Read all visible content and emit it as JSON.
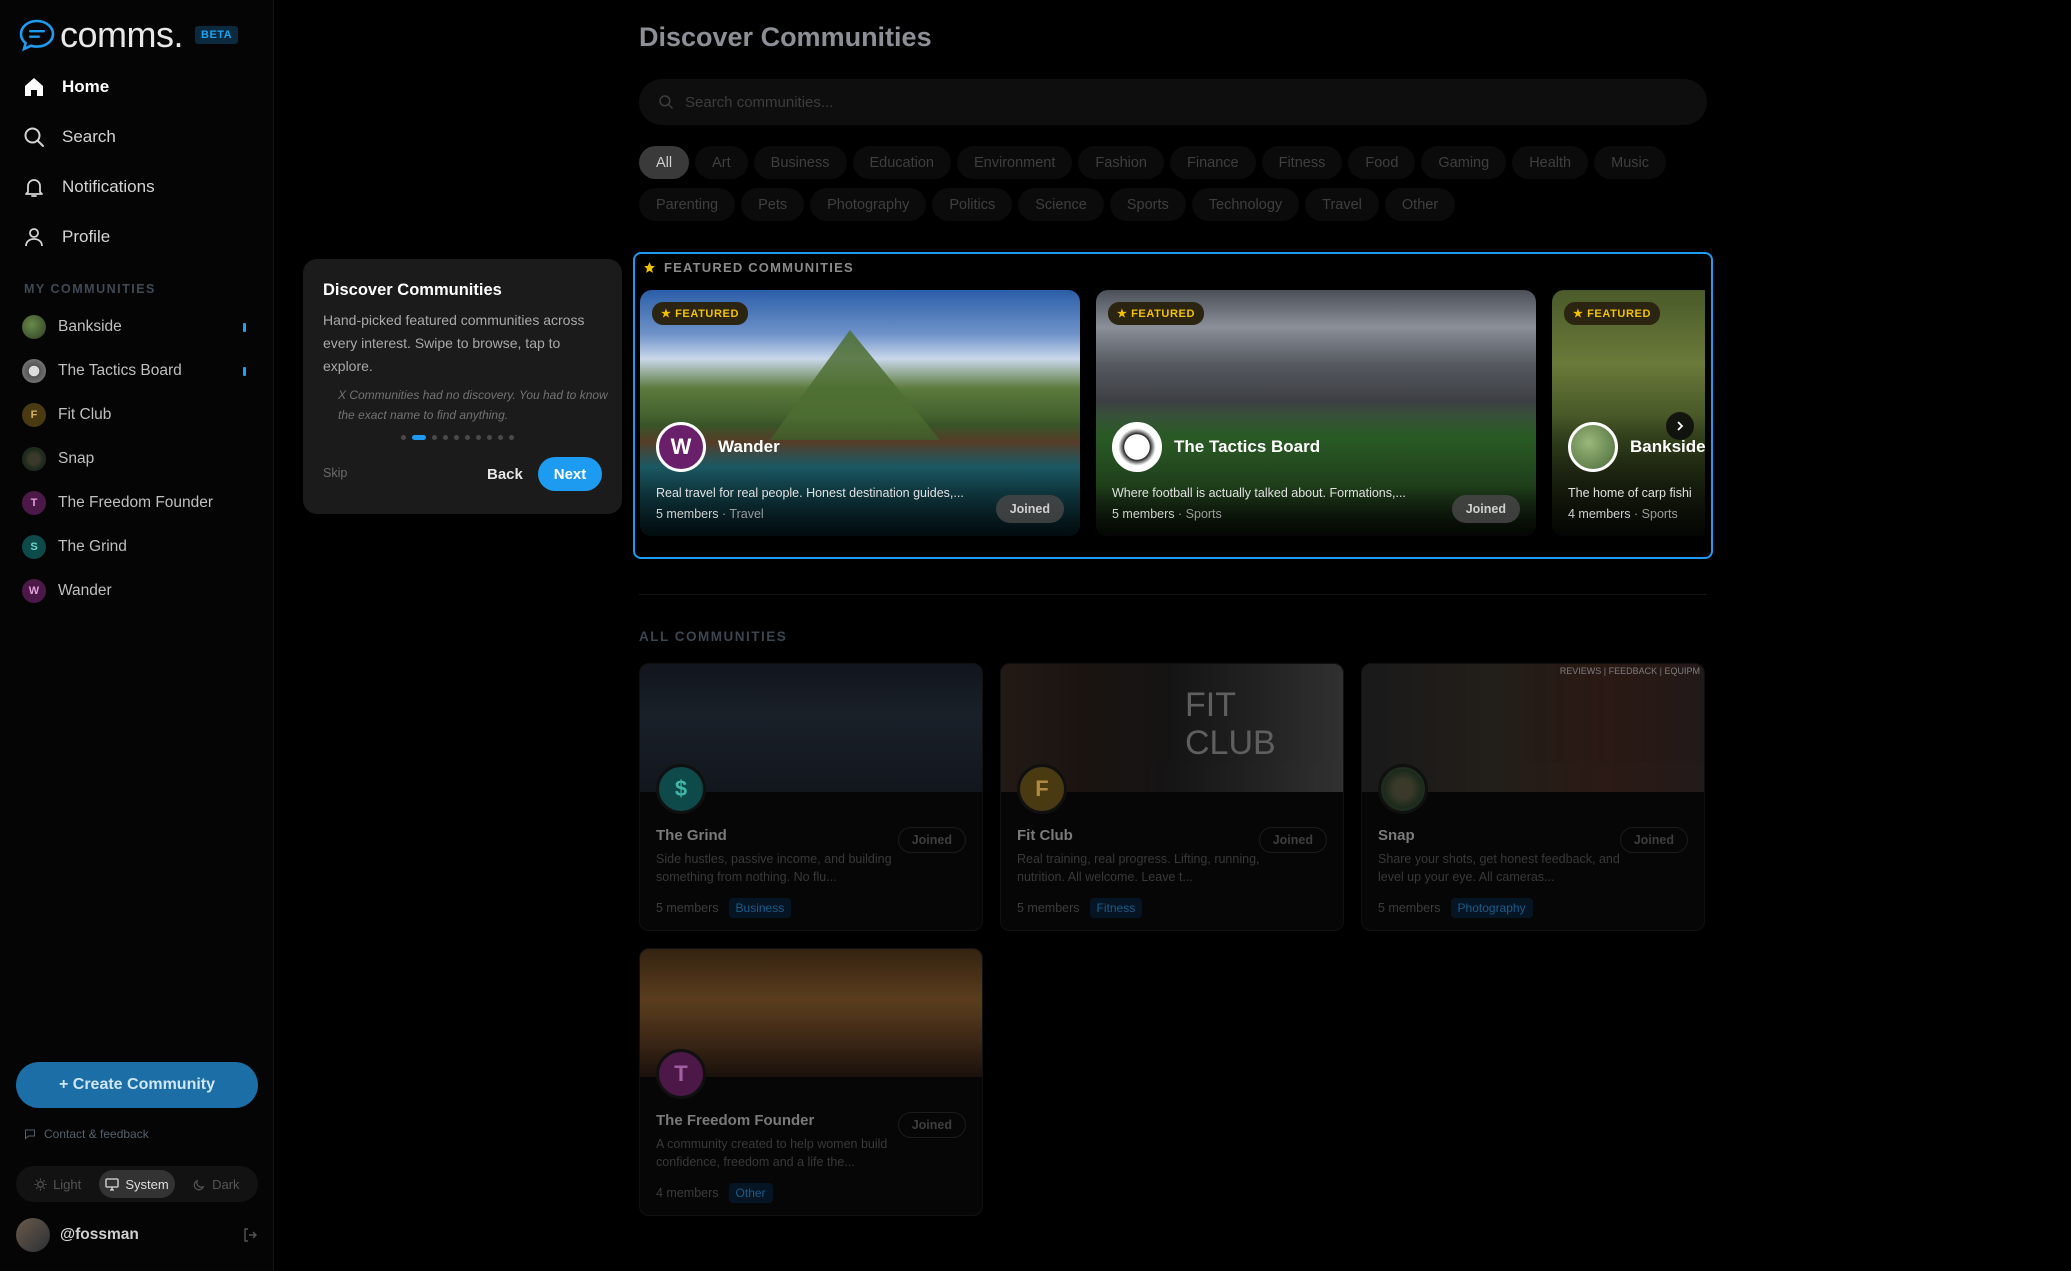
{
  "app": {
    "logo_text": "comms.",
    "beta_badge": "BETA"
  },
  "nav": [
    {
      "label": "Home",
      "icon": "home-icon"
    },
    {
      "label": "Search",
      "icon": "search-icon"
    },
    {
      "label": "Notifications",
      "icon": "bell-icon"
    },
    {
      "label": "Profile",
      "icon": "user-icon"
    }
  ],
  "my_communities": {
    "label": "MY COMMUNITIES",
    "items": [
      {
        "name": "Bankside",
        "initial": "",
        "unread": true
      },
      {
        "name": "The Tactics Board",
        "initial": "",
        "unread": true
      },
      {
        "name": "Fit Club",
        "initial": "F",
        "unread": false
      },
      {
        "name": "Snap",
        "initial": "",
        "unread": false
      },
      {
        "name": "The Freedom Founder",
        "initial": "T",
        "unread": false
      },
      {
        "name": "The Grind",
        "initial": "S",
        "unread": false
      },
      {
        "name": "Wander",
        "initial": "W",
        "unread": false
      }
    ]
  },
  "sidebar_footer": {
    "create_label": "+ Create Community",
    "contact_label": "Contact & feedback",
    "theme_options": [
      "Light",
      "System",
      "Dark"
    ],
    "theme_selected": "System",
    "username": "@fossman"
  },
  "main": {
    "title": "Discover Communities",
    "search_placeholder": "Search communities...",
    "categories_row1": [
      "All",
      "Art",
      "Business",
      "Education",
      "Environment",
      "Fashion",
      "Finance",
      "Fitness",
      "Food",
      "Gaming",
      "Health",
      "Music"
    ],
    "categories_row2": [
      "Parenting",
      "Pets",
      "Photography",
      "Politics",
      "Science",
      "Sports",
      "Technology",
      "Travel",
      "Other"
    ],
    "selected_category": "All",
    "featured_label": "FEATURED COMMUNITIES",
    "featured": [
      {
        "badge": "★ FEATURED",
        "name": "Wander",
        "initial": "W",
        "desc": "Real travel for real people. Honest destination guides,...",
        "members": "5 members",
        "category": "· Travel",
        "joined": "Joined"
      },
      {
        "badge": "★ FEATURED",
        "name": "The Tactics Board",
        "initial": "",
        "desc": "Where football is actually talked about. Formations,...",
        "members": "5 members",
        "category": "· Sports",
        "joined": "Joined"
      },
      {
        "badge": "★ FEATURED",
        "name": "Bankside",
        "initial": "",
        "desc": "The home of carp fishi",
        "members": "4 members",
        "category": "· Sports",
        "joined": ""
      }
    ],
    "all_label": "ALL COMMUNITIES",
    "communities": [
      {
        "name": "The Grind",
        "initial": "$",
        "desc": "Side hustles, passive income, and building something from nothing. No flu...",
        "members": "5 members",
        "tag": "Business",
        "joined": "Joined"
      },
      {
        "name": "Fit Club",
        "initial": "F",
        "desc": "Real training, real progress. Lifting, running, nutrition. All welcome. Leave t...",
        "members": "5 members",
        "tag": "Fitness",
        "joined": "Joined"
      },
      {
        "name": "Snap",
        "initial": "",
        "desc": "Share your shots, get honest feedback, and level up your eye. All cameras...",
        "members": "5 members",
        "tag": "Photography",
        "joined": "Joined"
      },
      {
        "name": "The Freedom Founder",
        "initial": "T",
        "desc": "A community created to help women build confidence, freedom and a life the...",
        "members": "4 members",
        "tag": "Other",
        "joined": "Joined"
      }
    ],
    "fit_club_banner_text": "FIT\nCLUB",
    "snap_banner_text": "REVIEWS | FEEDBACK | EQUIPM"
  },
  "tour": {
    "title": "Discover Communities",
    "body": "Hand-picked featured communities across every interest. Swipe to browse, tap to explore.",
    "quote": "X Communities had no discovery. You had to know the exact name to find anything.",
    "step_count": 10,
    "current_step": 2,
    "skip_label": "Skip",
    "back_label": "Back",
    "next_label": "Next"
  },
  "colors": {
    "accent": "#1d9bf0",
    "featured_gold": "#f2c200",
    "background": "#000000"
  }
}
